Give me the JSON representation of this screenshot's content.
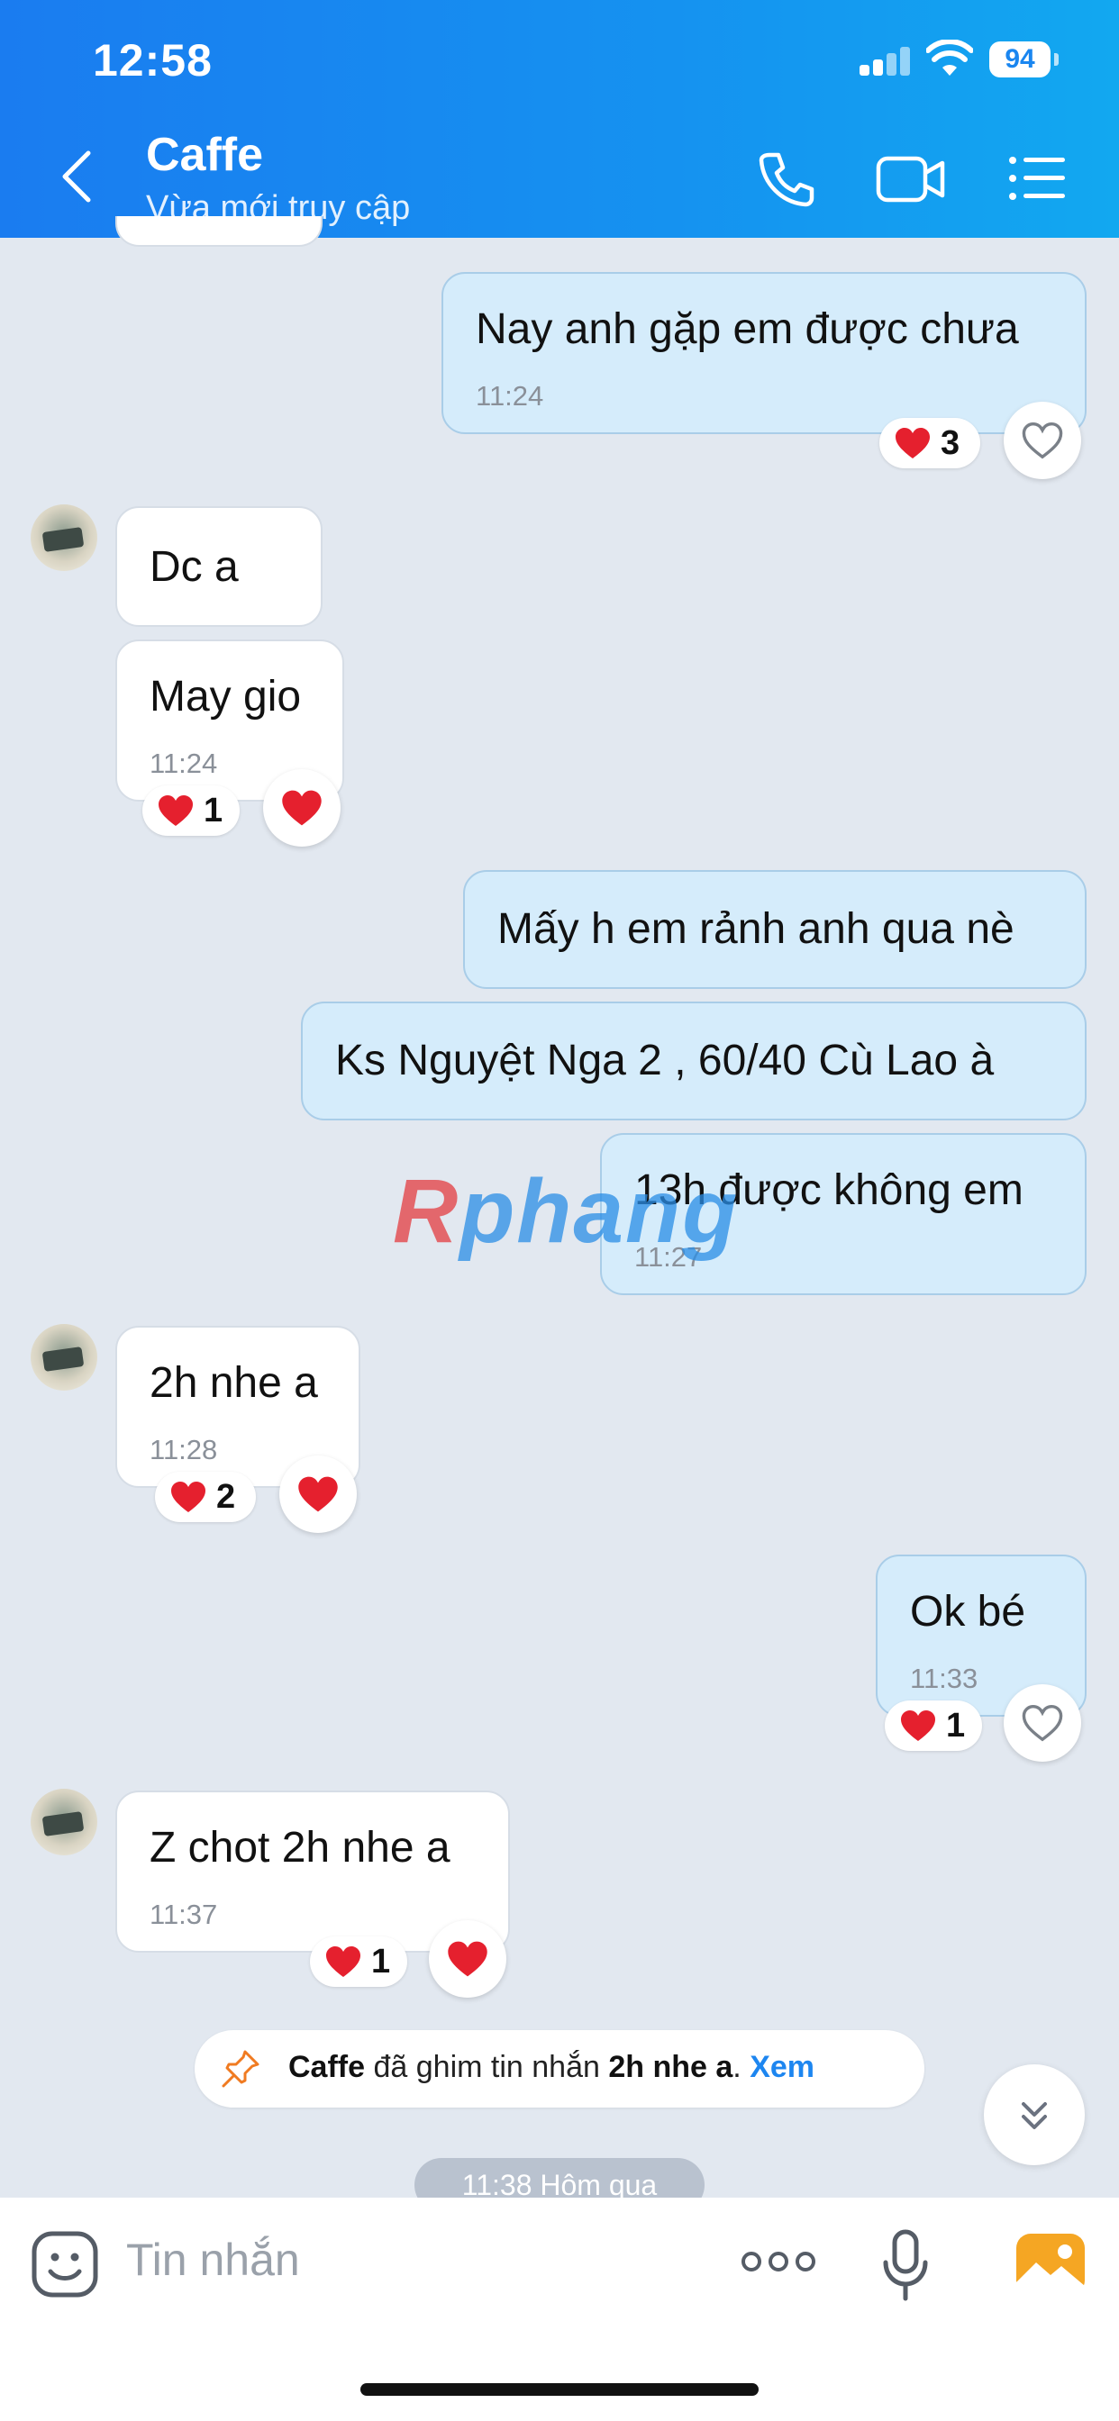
{
  "status_bar": {
    "time": "12:58",
    "battery": "94"
  },
  "header": {
    "title": "Caffe",
    "subtitle": "Vừa mới truy cập"
  },
  "messages": [
    {
      "text": "Nay anh gặp em được chưa",
      "time": "11:24",
      "reaction_count": "3"
    },
    {
      "text": "Dc a"
    },
    {
      "text": "May gio",
      "time": "11:24",
      "reaction_count": "1"
    },
    {
      "text": "Mấy h em rảnh anh qua nè"
    },
    {
      "text": "Ks Nguyệt Nga 2 , 60/40 Cù Lao à"
    },
    {
      "text": "13h được không em",
      "time": "11:27"
    },
    {
      "text": "2h nhe a",
      "time": "11:28",
      "reaction_count": "2"
    },
    {
      "text": "Ok bé",
      "time": "11:33",
      "reaction_count": "1"
    },
    {
      "text": "Z chot 2h nhe a",
      "time": "11:37",
      "reaction_count": "1"
    }
  ],
  "watermark": {
    "first": "R",
    "rest": "phang"
  },
  "pinned": {
    "sender": "Caffe",
    "action": "đã ghim tin nhắn",
    "message": "2h nhe a",
    "view_label": "Xem"
  },
  "time_separator": "11:38 Hôm qua",
  "composer": {
    "placeholder": "Tin nhắn"
  },
  "colors": {
    "header_start": "#1a7cf0",
    "header_end": "#12a8f0",
    "outgoing_bubble": "#d5ecfb",
    "heart": "#e5202e",
    "accent": "#1d86f0"
  }
}
